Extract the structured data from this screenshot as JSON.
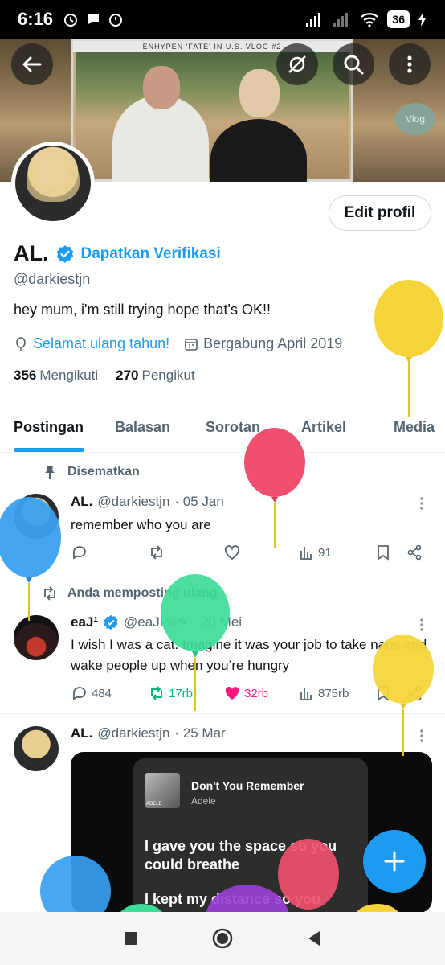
{
  "status_bar": {
    "time": "6:16",
    "battery": "36"
  },
  "banner": {
    "caption": "ENHYPEN 'FATE' IN U.S. VLOG #2",
    "vlog_badge": "Vlog"
  },
  "profile": {
    "name": "AL.",
    "verify_cta": "Dapatkan Verifikasi",
    "handle": "@darkiestjn",
    "bio": "hey mum, i'm still trying hope that's OK!!",
    "birthday": "Selamat ulang tahun!",
    "joined": "Bergabung April 2019",
    "following_count": "356",
    "following_label": "Mengikuti",
    "followers_count": "270",
    "followers_label": "Pengikut",
    "edit_button": "Edit profil"
  },
  "tabs": [
    "Postingan",
    "Balasan",
    "Sorotan",
    "Artikel",
    "Media"
  ],
  "posts": [
    {
      "context": "Disematkan",
      "name": "AL.",
      "handle": "@darkiestjn",
      "date": "· 05 Jan",
      "text": "remember who you are",
      "views": "91"
    },
    {
      "context": "Anda memposting ulang",
      "name": "eaJ¹",
      "handle": "@eaJPark",
      "date": "· 20 Mei",
      "text": "I wish I was a cat. Imagine it was your job to take naps and wake people up when you’re hungry",
      "replies": "484",
      "reposts": "17rb",
      "likes": "32rb",
      "views": "875rb"
    },
    {
      "name": "AL.",
      "handle": "@darkiestjn",
      "date": "· 25 Mar",
      "media": {
        "song": "Don't You Remember",
        "artist": "Adele",
        "art_label": "ADELE",
        "lyric_1": "I gave you the space so you could breathe",
        "lyric_2": "I kept my distance so you"
      }
    }
  ],
  "colors": {
    "accent": "#1d9bf0",
    "repost": "#00ba7c",
    "like": "#f91880",
    "balloon_yellow": "#f6d53b",
    "balloon_red": "#f0506e",
    "balloon_blue": "#3aa0f0",
    "balloon_green": "#3ddc97",
    "balloon_purple": "#9b3fd8"
  }
}
